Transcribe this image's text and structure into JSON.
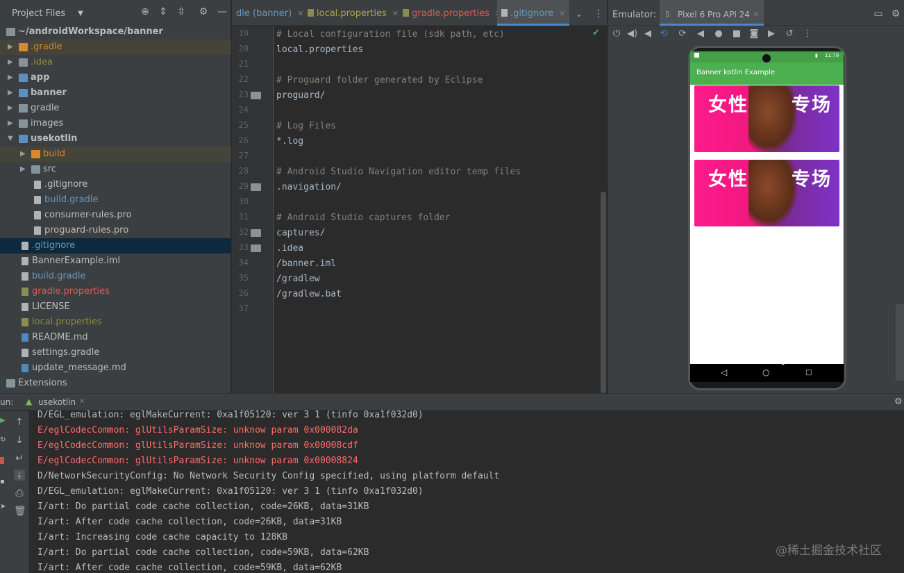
{
  "project_panel": {
    "title": "Project Files",
    "tree": [
      {
        "label": "~/androidWorkspace/banner",
        "icon": "folder-icon",
        "color": "#bbbbbb",
        "bold": true
      },
      {
        "label": ".gradle",
        "icon": "folder-icon",
        "color": "#d7892b"
      },
      {
        "label": ".idea",
        "icon": "folder-icon",
        "color": "#8c8c3c"
      },
      {
        "label": "app",
        "icon": "module-folder-icon",
        "color": "#bbbbbb",
        "bold": true
      },
      {
        "label": "banner",
        "icon": "module-folder-icon",
        "color": "#bbbbbb",
        "bold": true
      },
      {
        "label": "gradle",
        "icon": "folder-icon",
        "color": "#bbbbbb"
      },
      {
        "label": "images",
        "icon": "folder-icon",
        "color": "#bbbbbb"
      },
      {
        "label": "usekotlin",
        "icon": "module-folder-icon",
        "color": "#bbbbbb",
        "bold": true
      },
      {
        "label": "build",
        "icon": "folder-icon",
        "color": "#d7892b"
      },
      {
        "label": "src",
        "icon": "folder-icon",
        "color": "#bbbbbb"
      },
      {
        "label": ".gitignore",
        "icon": "file-icon",
        "color": "#bbbbbb"
      },
      {
        "label": "build.gradle",
        "icon": "gradle-icon",
        "color": "#6897bb"
      },
      {
        "label": "consumer-rules.pro",
        "icon": "file-icon",
        "color": "#bbbbbb"
      },
      {
        "label": "proguard-rules.pro",
        "icon": "file-icon",
        "color": "#bbbbbb"
      },
      {
        "label": ".gitignore",
        "icon": "file-icon",
        "color": "#6897bb"
      },
      {
        "label": "BannerExample.iml",
        "icon": "file-icon",
        "color": "#bbbbbb"
      },
      {
        "label": "build.gradle",
        "icon": "gradle-icon",
        "color": "#6897bb"
      },
      {
        "label": "gradle.properties",
        "icon": "properties-icon",
        "color": "#e05555"
      },
      {
        "label": "LICENSE",
        "icon": "file-icon",
        "color": "#bbbbbb"
      },
      {
        "label": "local.properties",
        "icon": "properties-icon",
        "color": "#8c8c3c"
      },
      {
        "label": "README.md",
        "icon": "markdown-icon",
        "color": "#bbbbbb"
      },
      {
        "label": "settings.gradle",
        "icon": "gradle-icon",
        "color": "#bbbbbb"
      },
      {
        "label": "update_message.md",
        "icon": "markdown-icon",
        "color": "#bbbbbb"
      },
      {
        "label": "Extensions",
        "icon": "folder-icon",
        "color": "#bbbbbb"
      }
    ]
  },
  "editor_tabs": [
    {
      "label": "dle (banner)",
      "color": "#6897bb"
    },
    {
      "label": "local.properties",
      "color": "#a8a83c"
    },
    {
      "label": "gradle.properties",
      "color": "#e05555"
    },
    {
      "label": ".gitignore",
      "color": "#6897bb"
    }
  ],
  "editor": {
    "lines": [
      {
        "num": "19",
        "text": "# Local configuration file (sdk path, etc)",
        "comment": true
      },
      {
        "num": "20",
        "text": "local.properties",
        "comment": false
      },
      {
        "num": "21",
        "text": "",
        "comment": false
      },
      {
        "num": "22",
        "text": "# Proguard folder generated by Eclipse",
        "comment": true
      },
      {
        "num": "23",
        "text": "proguard/",
        "comment": false
      },
      {
        "num": "24",
        "text": "",
        "comment": false
      },
      {
        "num": "25",
        "text": "# Log Files",
        "comment": true
      },
      {
        "num": "26",
        "text": "*.log",
        "comment": false
      },
      {
        "num": "27",
        "text": "",
        "comment": false
      },
      {
        "num": "28",
        "text": "# Android Studio Navigation editor temp files",
        "comment": true
      },
      {
        "num": "29",
        "text": ".navigation/",
        "comment": false
      },
      {
        "num": "30",
        "text": "",
        "comment": false
      },
      {
        "num": "31",
        "text": "# Android Studio captures folder",
        "comment": true
      },
      {
        "num": "32",
        "text": "captures/",
        "comment": false
      },
      {
        "num": "33",
        "text": ".idea",
        "comment": false
      },
      {
        "num": "34",
        "text": "/banner.iml",
        "comment": false
      },
      {
        "num": "35",
        "text": "/gradlew",
        "comment": false
      },
      {
        "num": "36",
        "text": "/gradlew.bat",
        "comment": false
      },
      {
        "num": "37",
        "text": "",
        "comment": false
      }
    ]
  },
  "emulator": {
    "label": "Emulator:",
    "device_tab": "Pixel 6 Pro API 24",
    "status_time": "11:79",
    "app_title": "Banner kotlin Example",
    "banner_text_left": "女性",
    "banner_text_right": "专场"
  },
  "run_panel": {
    "label": "un:",
    "config_tab": "usekotlin",
    "log_lines": [
      {
        "text": "D/EGL_emulation: eglMakeCurrent: 0xa1f05120: ver 3 1 (tinfo 0xa1f032d0)",
        "level": "D"
      },
      {
        "text": "E/eglCodecCommon: glUtilsParamSize: unknow param 0x000082da",
        "level": "E"
      },
      {
        "text": "E/eglCodecCommon: glUtilsParamSize: unknow param 0x00008cdf",
        "level": "E"
      },
      {
        "text": "E/eglCodecCommon: glUtilsParamSize: unknow param 0x00008824",
        "level": "E"
      },
      {
        "text": "D/NetworkSecurityConfig: No Network Security Config specified, using platform default",
        "level": "D"
      },
      {
        "text": "D/EGL_emulation: eglMakeCurrent: 0xa1f05120: ver 3 1 (tinfo 0xa1f032d0)",
        "level": "D"
      },
      {
        "text": "I/art: Do partial code cache collection, code=26KB, data=31KB",
        "level": "I"
      },
      {
        "text": "I/art: After code cache collection, code=26KB, data=31KB",
        "level": "I"
      },
      {
        "text": "I/art: Increasing code cache capacity to 128KB",
        "level": "I"
      },
      {
        "text": "I/art: Do partial code cache collection, code=59KB, data=62KB",
        "level": "I"
      },
      {
        "text": "I/art: After code cache collection, code=59KB, data=62KB",
        "level": "I"
      }
    ]
  },
  "watermark": "@稀土掘金技术社区"
}
